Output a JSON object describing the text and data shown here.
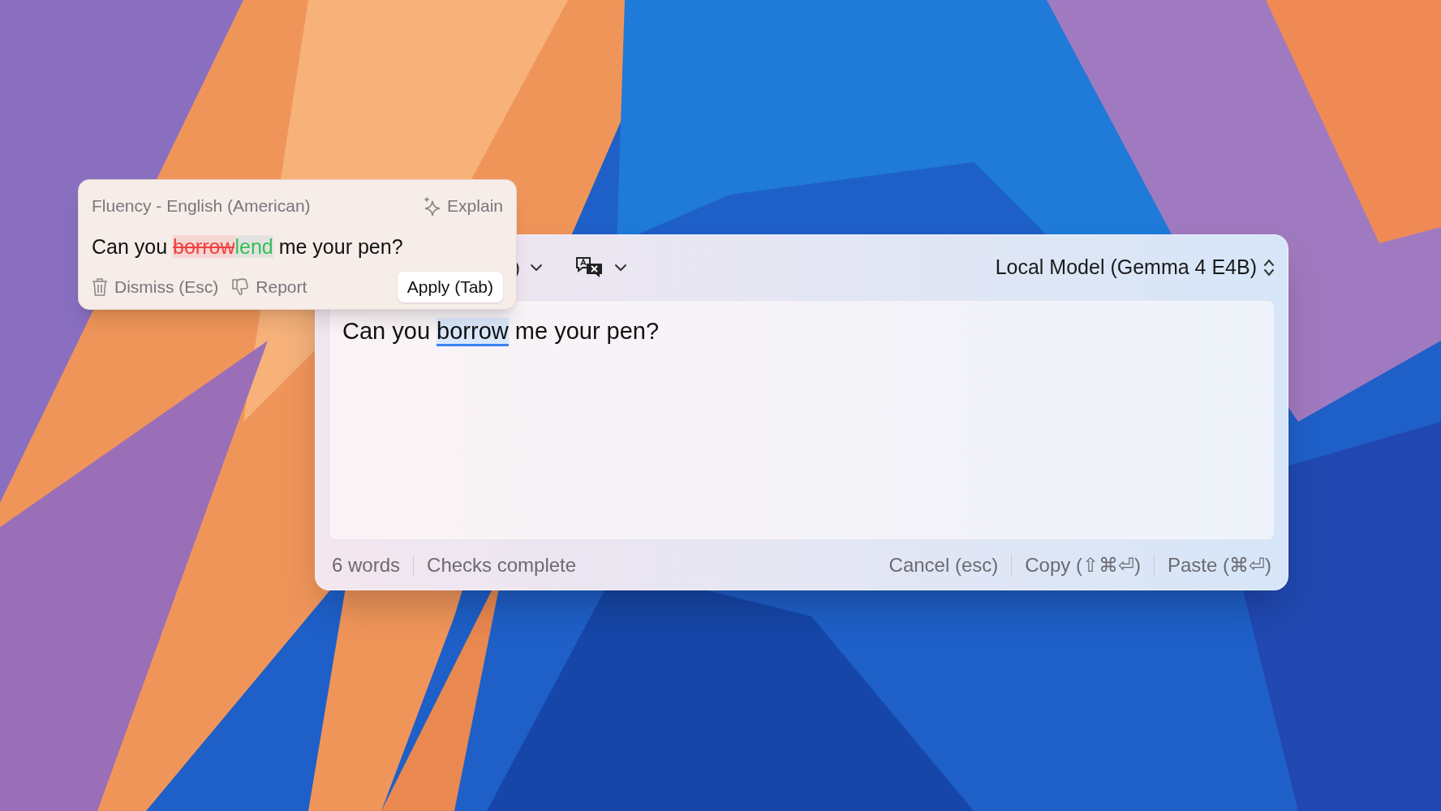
{
  "popup": {
    "category": "Fluency - English (American)",
    "explain": "Explain",
    "suggestion": {
      "before": "Can you ",
      "removed": "borrow",
      "inserted": "lend",
      "after": " me your pen?"
    },
    "dismiss": "Dismiss (Esc)",
    "report": "Report",
    "apply": "Apply (Tab)"
  },
  "window": {
    "toolbar": {
      "cut_label": ")",
      "model": "Local Model (Gemma 4 E4B)"
    },
    "editor": {
      "before": "Can you ",
      "flagged": "borrow",
      "after": " me your pen?"
    },
    "status": {
      "word_count": "6 words",
      "checks": "Checks complete"
    },
    "actions": [
      "Cancel (esc)",
      "Copy (⇧⌘⏎)",
      "Paste (⌘⏎)"
    ]
  }
}
